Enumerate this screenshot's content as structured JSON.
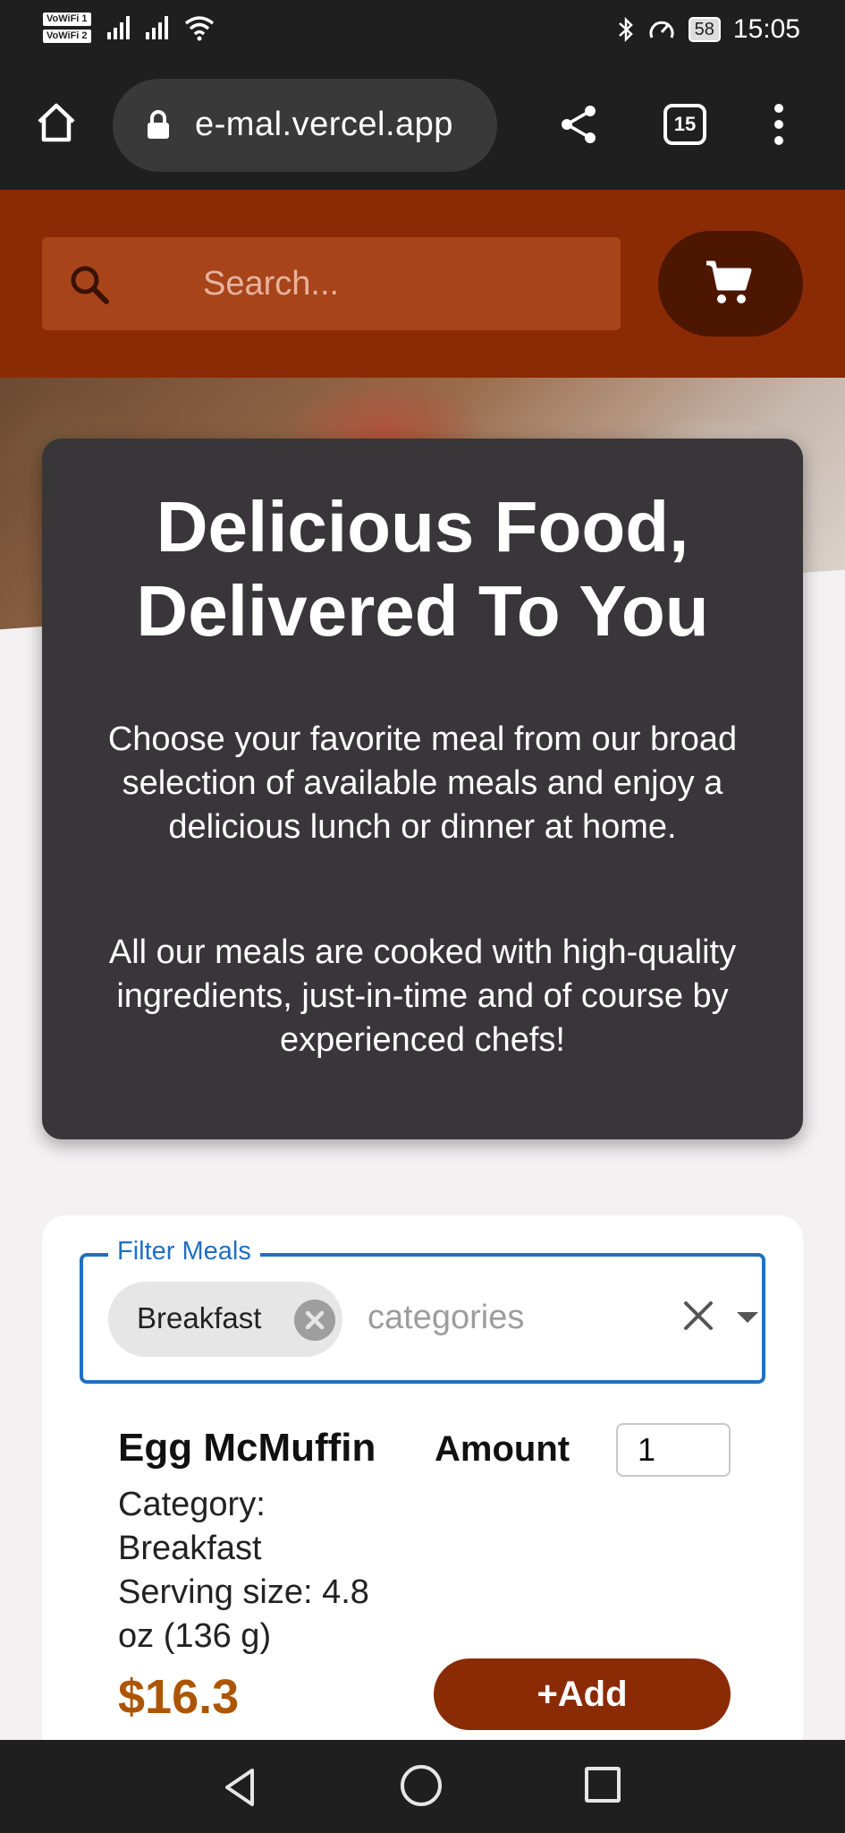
{
  "status_bar": {
    "sim1": "VoWiFi 1",
    "sim2": "VoWiFi 2",
    "battery": "58",
    "time": "15:05"
  },
  "browser": {
    "url": "e-mal.vercel.app",
    "tab_count": "15"
  },
  "header": {
    "search_placeholder": "Search...",
    "accent_color": "#8a2b06"
  },
  "summary": {
    "title": "Delicious Food, Delivered To You",
    "paragraph1": "Choose your favorite meal from our broad selection of available meals and enjoy a delicious lunch or dinner at home.",
    "paragraph2": "All our meals are cooked with high-quality ingredients, just-in-time and of course by experienced chefs!"
  },
  "filter": {
    "legend": "Filter Meals",
    "selected_chip": "Breakfast",
    "placeholder": "categories"
  },
  "meal": {
    "name": "Egg McMuffin",
    "amount_label": "Amount",
    "amount_value": "1",
    "category_line": "Category: Breakfast",
    "serving_line": "Serving size: 4.8 oz (136 g)",
    "price": "$16.3",
    "add_label": "+Add"
  }
}
